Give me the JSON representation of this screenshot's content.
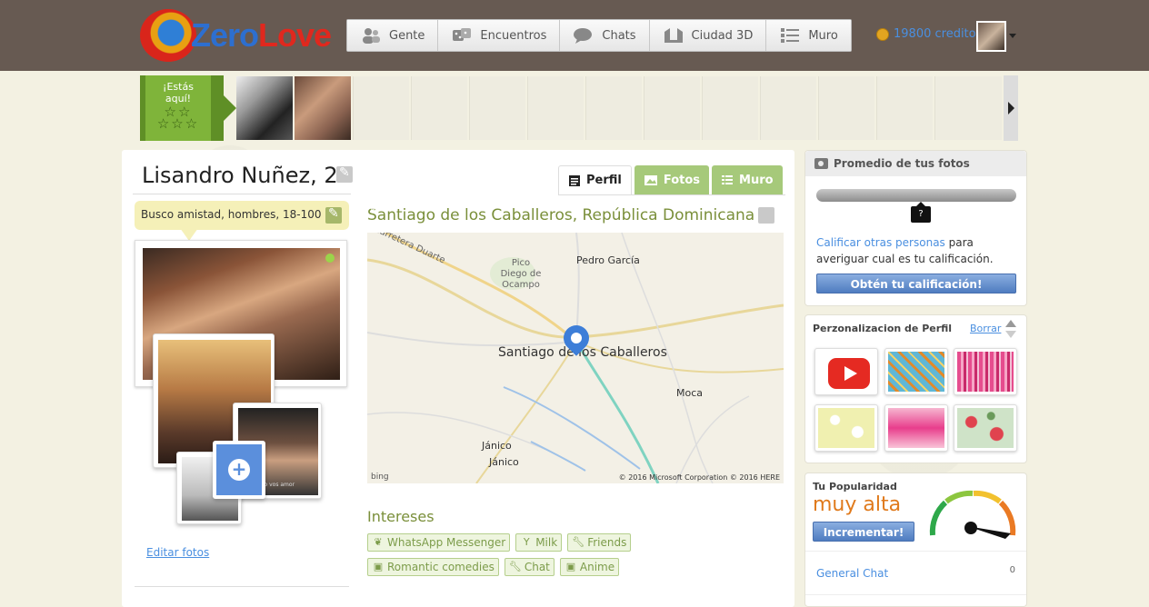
{
  "header": {
    "logo_text_a": "Zero",
    "logo_text_b": "Love",
    "nav": [
      {
        "label": "Gente",
        "icon": "people-icon"
      },
      {
        "label": "Encuentros",
        "icon": "dice-icon"
      },
      {
        "label": "Chats",
        "icon": "chat-bubble-icon"
      },
      {
        "label": "Ciudad 3D",
        "icon": "city-icon"
      },
      {
        "label": "Muro",
        "icon": "list-icon"
      }
    ],
    "credits": "19800 creditos"
  },
  "strip": {
    "here_label_1": "¡Estás",
    "here_label_2": "aquí!",
    "stars": "☆☆ ☆☆☆"
  },
  "profile": {
    "name": "Lisandro Nuñez, 22",
    "looking_for": "Busco amistad, hombres, 18-100",
    "location": "Santiago de los Caballeros, República Dominicana",
    "edit_photos": "Editar fotos",
    "photo_caption": "yo vos amor",
    "tabs": [
      {
        "label": "Perfil",
        "icon": "document-icon"
      },
      {
        "label": "Fotos",
        "icon": "photos-icon"
      },
      {
        "label": "Muro",
        "icon": "list-icon"
      }
    ],
    "interests_title": "Intereses",
    "interests": [
      {
        "label": "WhatsApp Messenger",
        "icon": "leaf-icon"
      },
      {
        "label": "Milk",
        "icon": "glass-icon"
      },
      {
        "label": "Friends",
        "icon": "wrench-icon"
      },
      {
        "label": "Romantic comedies",
        "icon": "tv-icon"
      },
      {
        "label": "Chat",
        "icon": "wrench-icon"
      },
      {
        "label": "Anime",
        "icon": "tv-icon"
      }
    ]
  },
  "map": {
    "labels": {
      "road": "Carretera Duarte",
      "pico": "Pico Diego de Ocampo",
      "pedro": "Pedro García",
      "santiago": "Santiago de los Caballeros",
      "moca": "Moca",
      "janico1": "Jánico",
      "janico2": "Jánico"
    },
    "bing": "bing",
    "copyright": "© 2016 Microsoft Corporation © 2016 HERE"
  },
  "sidebar": {
    "rating_title": "Promedio de tus fotos",
    "rating_value": "?",
    "rate_link": "Calificar otras personas",
    "rate_text_1": " para",
    "rate_text_2": "averiguar cual es tu calificación.",
    "rate_button": "Obtén tu calificación!",
    "custom_title": "Perzonalizacion de Perfil",
    "custom_clear": "Borrar",
    "popularity_label": "Tu Popularidad",
    "popularity_value": "muy alta",
    "popularity_button": "Incrementar!",
    "chat_label": "General Chat",
    "chat_count": "0"
  },
  "colors": {
    "header_bg": "#675a52",
    "accent_green": "#7fb43a",
    "link_blue": "#4a8fe0",
    "popularity_orange": "#e07a1c"
  }
}
